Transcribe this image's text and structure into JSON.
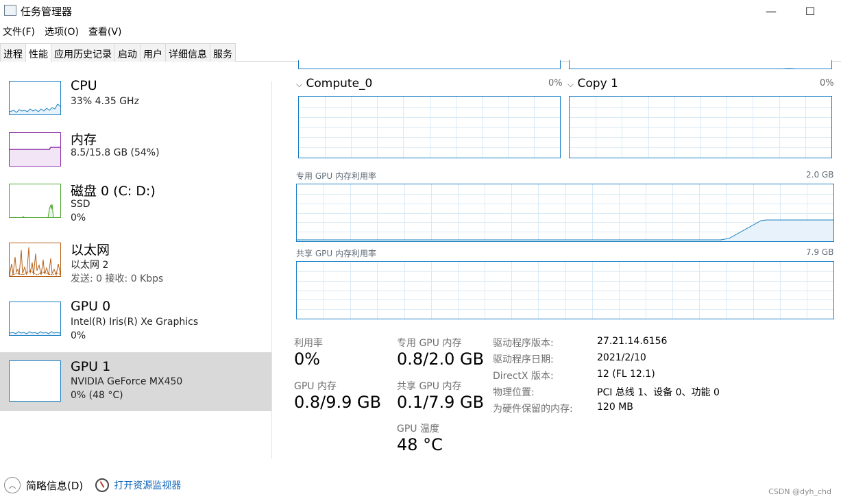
{
  "window": {
    "title": "任务管理器",
    "minimize_glyph": "—",
    "maximize_glyph": "☐"
  },
  "menu": [
    "文件(F)",
    "选项(O)",
    "查看(V)"
  ],
  "tabs": [
    "进程",
    "性能",
    "应用历史记录",
    "启动",
    "用户",
    "详细信息",
    "服务"
  ],
  "active_tab_index": 1,
  "sidebar": [
    {
      "title": "CPU",
      "line1": "33% 4.35 GHz",
      "line2": "",
      "line3": "",
      "color": "#1a7fc3",
      "selected": false
    },
    {
      "title": "内存",
      "line1": "8.5/15.8 GB (54%)",
      "line2": "",
      "line3": "",
      "color": "#8b2fa6",
      "selected": false
    },
    {
      "title": "磁盘 0 (C: D:)",
      "line1": "SSD",
      "line2": "0%",
      "line3": "",
      "color": "#4da62f",
      "selected": false
    },
    {
      "title": "以太网",
      "line1": "以太网 2",
      "line2": "发送: 0 接收: 0 Kbps",
      "line3": "",
      "color": "#b55e14",
      "selected": false
    },
    {
      "title": "GPU 0",
      "line1": "Intel(R) Iris(R) Xe Graphics",
      "line2": "0%",
      "line3": "",
      "color": "#1a7fc3",
      "selected": false
    },
    {
      "title": "GPU 1",
      "line1": "NVIDIA GeForce MX450",
      "line2": "0% (48 °C)",
      "line3": "",
      "color": "#1a7fc3",
      "selected": true
    }
  ],
  "engines": [
    {
      "name": "Compute_0",
      "percent": "0%"
    },
    {
      "name": "Copy 1",
      "percent": "0%"
    }
  ],
  "dedicated_graph": {
    "label": "专用 GPU 内存利用率",
    "max": "2.0 GB"
  },
  "shared_graph": {
    "label": "共享 GPU 内存利用率",
    "max": "7.9 GB"
  },
  "stats": {
    "util_label": "利用率",
    "util_value": "0%",
    "gpu_mem_label": "GPU 内存",
    "gpu_mem_value": "0.8/9.9 GB",
    "dedicated_label": "专用 GPU 内存",
    "dedicated_value": "0.8/2.0 GB",
    "shared_label": "共享 GPU 内存",
    "shared_value": "0.1/7.9 GB",
    "temp_label": "GPU 温度",
    "temp_value": "48 °C"
  },
  "info": [
    {
      "key": "驱动程序版本:",
      "value": "27.21.14.6156"
    },
    {
      "key": "驱动程序日期:",
      "value": "2021/2/10"
    },
    {
      "key": "DirectX 版本:",
      "value": "12 (FL 12.1)"
    },
    {
      "key": "物理位置:",
      "value": "PCI 总线 1、设备 0、功能 0"
    },
    {
      "key": "为硬件保留的内存:",
      "value": "120 MB"
    }
  ],
  "footer": {
    "summary_label": "简略信息(D)",
    "monitor_link": "打开资源监视器"
  },
  "watermark": "CSDN @dyh_chd"
}
